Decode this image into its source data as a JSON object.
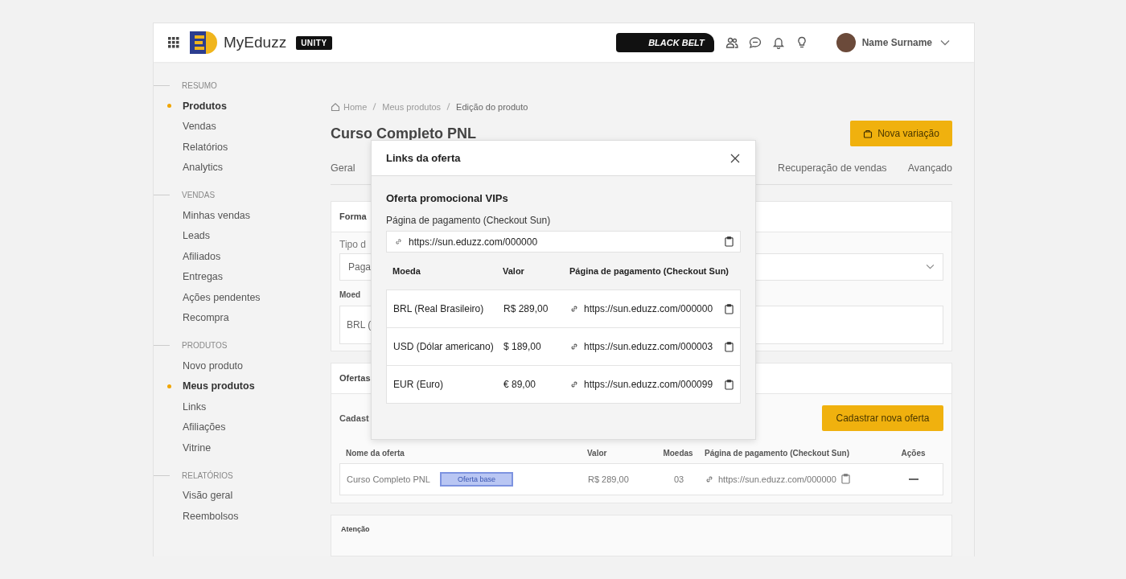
{
  "header": {
    "logo": "MyEduzz",
    "badge": "UNITY",
    "belt": "BLACK BELT",
    "user": "Name Surname"
  },
  "sidebar": [
    {
      "title": "RESUMO",
      "items": [
        {
          "label": "Produtos",
          "selected": true
        },
        {
          "label": "Vendas",
          "selected": false
        },
        {
          "label": "Relatórios",
          "selected": false
        },
        {
          "label": "Analytics",
          "selected": false
        }
      ]
    },
    {
      "title": "VENDAS",
      "items": [
        {
          "label": "Minhas vendas",
          "selected": false
        },
        {
          "label": "Leads",
          "selected": false
        },
        {
          "label": "Afiliados",
          "selected": false
        },
        {
          "label": "Entregas",
          "selected": false
        },
        {
          "label": "Ações pendentes",
          "selected": false
        },
        {
          "label": "Recompra",
          "selected": false
        }
      ]
    },
    {
      "title": "PRODUTOS",
      "items": [
        {
          "label": "Novo produto",
          "selected": false
        },
        {
          "label": "Meus produtos",
          "selected": true
        },
        {
          "label": "Links",
          "selected": false
        },
        {
          "label": "Afiliações",
          "selected": false
        },
        {
          "label": "Vitrine",
          "selected": false
        }
      ]
    },
    {
      "title": "RELATÓRIOS",
      "items": [
        {
          "label": "Visão geral",
          "selected": false
        },
        {
          "label": "Reembolsos",
          "selected": false
        }
      ]
    }
  ],
  "breadcrumb": [
    "Home",
    "Meus produtos",
    "Edição do produto"
  ],
  "page_title": "Curso Completo PNL",
  "new_variation_button": "Nova variação",
  "tabs": [
    {
      "label": "Geral",
      "selected": false
    },
    {
      "label": "Recuperação de vendas",
      "selected": false
    },
    {
      "label": "Avançado",
      "selected": false
    }
  ],
  "payment_card": {
    "title": "Forma",
    "type_label": "Tipo d",
    "type_value": "Paga",
    "currency_label": "Moed",
    "currency_value": "BRL ("
  },
  "offers_card": {
    "title": "Ofertas",
    "description": "Cadast",
    "button": "Cadastrar nova oferta",
    "columns": [
      "Nome da oferta",
      "Valor",
      "Moedas",
      "Página de pagamento (Checkout Sun)",
      "Ações"
    ],
    "rows": [
      {
        "name": "Curso Completo PNL",
        "tag": "Oferta base",
        "value": "R$ 289,00",
        "currencies": "03",
        "link": "https://sun.eduzz.com/000000"
      }
    ]
  },
  "notice_card": {
    "title": "Atenção"
  },
  "modal": {
    "title": "Links da oferta",
    "offer_name": "Oferta promocional VIPs",
    "field_label": "Página de pagamento (Checkout Sun)",
    "field_value": "https://sun.eduzz.com/000000",
    "columns": [
      "Moeda",
      "Valor",
      "Página de pagamento (Checkout Sun)"
    ],
    "rows": [
      {
        "currency": "BRL (Real Brasileiro)",
        "value": "R$ 289,00",
        "link": "https://sun.eduzz.com/000000"
      },
      {
        "currency": "USD (Dólar americano)",
        "value": "$ 189,00",
        "link": "https://sun.eduzz.com/000003"
      },
      {
        "currency": "EUR (Euro)",
        "value": "€ 89,00",
        "link": "https://sun.eduzz.com/000099"
      }
    ]
  }
}
